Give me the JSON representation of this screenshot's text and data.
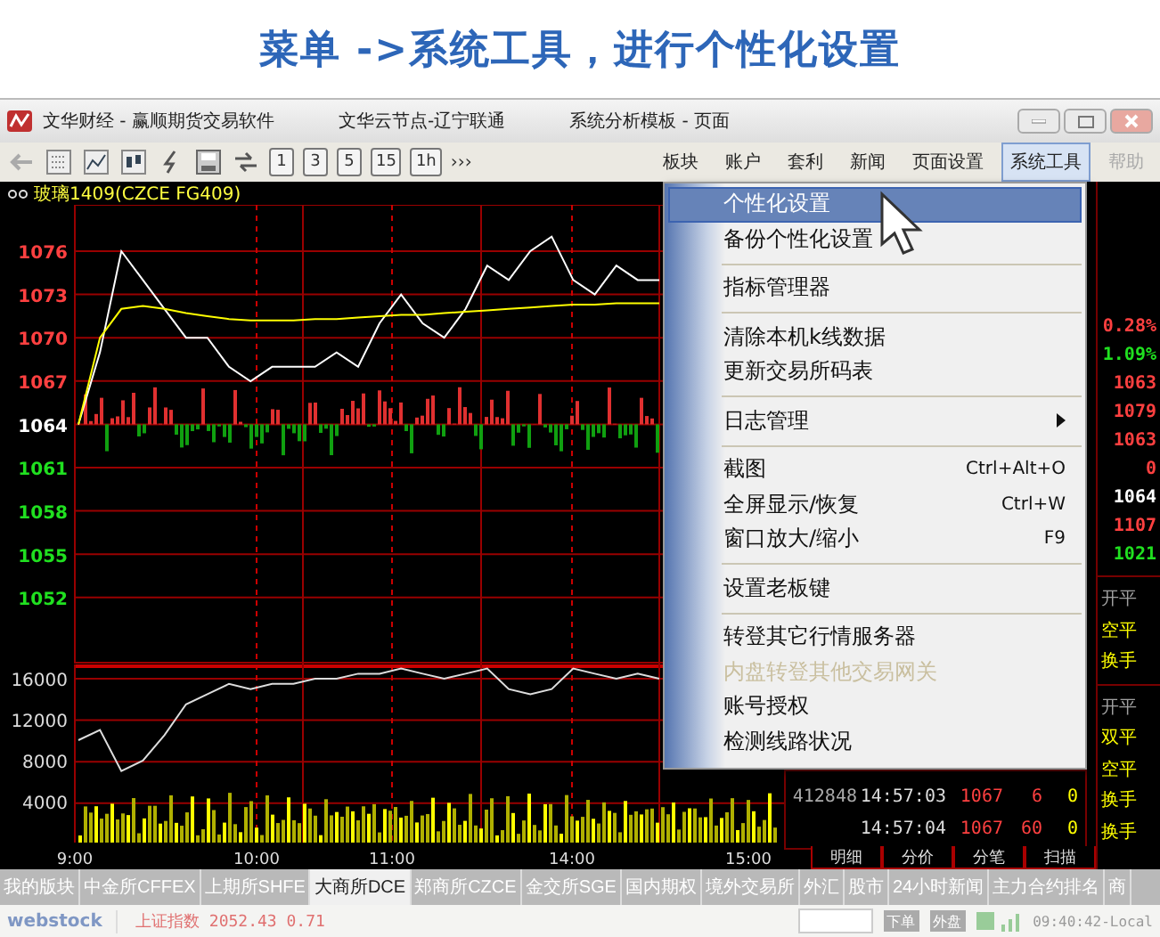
{
  "banner": {
    "title": "菜单 ->系统工具，进行个性化设置"
  },
  "window": {
    "title_parts": [
      "文华财经 - 赢顺期货交易软件",
      "文华云节点-辽宁联通",
      "系统分析模板 - 页面"
    ]
  },
  "toolbar": {
    "period_buttons": [
      "1",
      "3",
      "5",
      "15",
      "1h"
    ],
    "more": "›››",
    "menus": [
      {
        "label": "板块",
        "selected": false,
        "disabled": false
      },
      {
        "label": "账户",
        "selected": false,
        "disabled": false
      },
      {
        "label": "套利",
        "selected": false,
        "disabled": false
      },
      {
        "label": "新闻",
        "selected": false,
        "disabled": false
      },
      {
        "label": "页面设置",
        "selected": false,
        "disabled": false
      },
      {
        "label": "系统工具",
        "selected": true,
        "disabled": false
      },
      {
        "label": "帮助",
        "selected": false,
        "disabled": true
      }
    ]
  },
  "chart": {
    "title": "玻璃1409(CZCE FG409)",
    "tick_styles": [
      {
        "color": "#ff4040"
      },
      {
        "color": "#ff4040"
      },
      {
        "color": "#ff4040"
      },
      {
        "color": "#ff4040"
      },
      {
        "color": "#ffffff"
      },
      {
        "color": "#20e020"
      },
      {
        "color": "#20e020"
      },
      {
        "color": "#20e020"
      },
      {
        "color": "#20e020"
      }
    ],
    "chart_data": {
      "type": "line",
      "grid": true,
      "ylim": [
        1047.4,
        1079.2
      ],
      "yticks": [
        1076,
        1073,
        1070,
        1067,
        1064,
        1061,
        1058,
        1055,
        1052
      ],
      "series": [
        {
          "color": "#ffffff",
          "values": [
            1064,
            1069,
            1076,
            1074,
            1072,
            1070,
            1070,
            1068,
            1067,
            1068,
            1068,
            1068,
            1069,
            1068,
            1071,
            1073,
            1071,
            1070,
            1072,
            1075,
            1074,
            1076,
            1077,
            1074,
            1073,
            1075,
            1074,
            1074
          ]
        },
        {
          "color": "#ffff00",
          "values": [
            1064,
            1070,
            1072,
            1072.2,
            1072,
            1071.7,
            1071.5,
            1071.3,
            1071.2,
            1071.2,
            1071.2,
            1071.3,
            1071.3,
            1071.4,
            1071.5,
            1071.6,
            1071.6,
            1071.7,
            1071.8,
            1071.9,
            1072,
            1072.1,
            1072.2,
            1072.3,
            1072.3,
            1072.4,
            1072.4,
            1072.4
          ]
        }
      ]
    }
  },
  "volume_chart": {
    "time_labels": [
      "9:00",
      "10:00",
      "11:00",
      "14:00",
      "15:00"
    ],
    "chart_data": {
      "type": "line",
      "grid": true,
      "ylim": [
        0,
        17400
      ],
      "yticks": [
        16000,
        12000,
        8000,
        4000
      ],
      "series": [
        {
          "color": "#dddddd",
          "values": [
            10000,
            11000,
            7000,
            8000,
            10500,
            13500,
            14500,
            15500,
            15000,
            15500,
            15500,
            16000,
            16000,
            16500,
            16500,
            17000,
            16500,
            16000,
            16500,
            17000,
            15000,
            14500,
            15000,
            17000,
            16500,
            16000,
            16500,
            16000
          ]
        }
      ]
    }
  },
  "right_panel": {
    "values": [
      {
        "text": "0.28%",
        "color": "#ff4040"
      },
      {
        "text": "1.09%",
        "color": "#20e020"
      },
      {
        "text": "1063",
        "color": "#ff4040"
      },
      {
        "text": "1079",
        "color": "#ff4040"
      },
      {
        "text": "1063",
        "color": "#ff4040"
      },
      {
        "text": "0",
        "color": "#ff4040"
      },
      {
        "text": "1064",
        "color": "#ffffff"
      },
      {
        "text": "1107",
        "color": "#ff4040"
      },
      {
        "text": "1021",
        "color": "#20e020"
      }
    ],
    "labels": [
      {
        "text": "开平",
        "color": "#a0a0a0"
      },
      {
        "text": "空平",
        "color": "#ffff00"
      },
      {
        "text": "换手",
        "color": "#ffff00"
      },
      {
        "text": "开平",
        "color": "#a0a0a0"
      },
      {
        "text": "双平",
        "color": "#ffff00"
      },
      {
        "text": "空平",
        "color": "#ffff00"
      },
      {
        "text": "换手",
        "color": "#ffff00"
      },
      {
        "text": "换手",
        "color": "#ffff00"
      }
    ]
  },
  "trades": [
    {
      "volume": "412848",
      "time": "14:57:03",
      "price": "1067",
      "size": "6",
      "change": "0"
    },
    {
      "time": "14:57:04",
      "price": "1067",
      "size": "60",
      "change": "0"
    }
  ],
  "menu": [
    {
      "kind": "item",
      "label": "个性化设置",
      "selected": true,
      "disabled": false
    },
    {
      "kind": "item",
      "label": "备份个性化设置",
      "selected": false,
      "disabled": false
    },
    {
      "kind": "separator"
    },
    {
      "kind": "item",
      "label": "指标管理器",
      "selected": false,
      "disabled": false
    },
    {
      "kind": "separator"
    },
    {
      "kind": "item",
      "label": "清除本机k线数据",
      "selected": false,
      "disabled": false
    },
    {
      "kind": "item",
      "label": "更新交易所码表",
      "selected": false,
      "disabled": false
    },
    {
      "kind": "separator"
    },
    {
      "kind": "submenu",
      "label": "日志管理",
      "selected": false,
      "disabled": false
    },
    {
      "kind": "separator"
    },
    {
      "kind": "item",
      "label": "截图",
      "shortcut": "Ctrl+Alt+O",
      "selected": false,
      "disabled": false
    },
    {
      "kind": "item",
      "label": "全屏显示/恢复",
      "shortcut": "Ctrl+W",
      "selected": false,
      "disabled": false
    },
    {
      "kind": "item",
      "label": "窗口放大/缩小",
      "shortcut": "F9",
      "selected": false,
      "disabled": false
    },
    {
      "kind": "separator"
    },
    {
      "kind": "item",
      "label": "设置老板键",
      "selected": false,
      "disabled": false
    },
    {
      "kind": "separator"
    },
    {
      "kind": "item",
      "label": "转登其它行情服务器",
      "selected": false,
      "disabled": false
    },
    {
      "kind": "item",
      "label": "内盘转登其他交易网关",
      "selected": false,
      "disabled": true
    },
    {
      "kind": "item",
      "label": "账号授权",
      "selected": false,
      "disabled": false
    },
    {
      "kind": "item",
      "label": "检测线路状况",
      "selected": false,
      "disabled": false
    }
  ],
  "detail_tabs": [
    "明细",
    "分价",
    "分笔",
    "扫描"
  ],
  "market_tabs": [
    {
      "label": "我的版块",
      "selected": false
    },
    {
      "label": "中金所CFFEX",
      "selected": false
    },
    {
      "label": "上期所SHFE",
      "selected": false
    },
    {
      "label": "大商所DCE",
      "selected": true
    },
    {
      "label": "郑商所CZCE",
      "selected": false
    },
    {
      "label": "金交所SGE",
      "selected": false
    },
    {
      "label": "国内期权",
      "selected": false
    },
    {
      "label": "境外交易所",
      "selected": false
    },
    {
      "label": "外汇",
      "selected": false
    },
    {
      "label": "股市",
      "selected": false
    },
    {
      "label": "24小时新闻",
      "selected": false
    },
    {
      "label": "主力合约排名",
      "selected": false
    },
    {
      "label": "商",
      "selected": false
    }
  ],
  "status_bar": {
    "logo": "webstock",
    "index": "上证指数 2052.43 0.71",
    "buttons": [
      "下单",
      "外盘"
    ],
    "clock": "09:40:42-Local"
  }
}
